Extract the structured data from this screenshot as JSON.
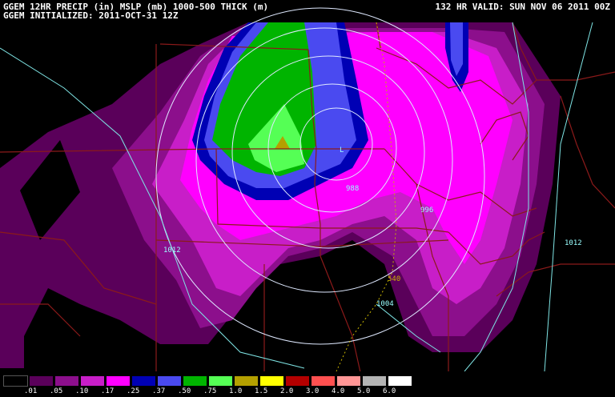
{
  "header": {
    "line1": "GGEM 12HR PRECIP (in) MSLP (mb) 1000-500 THICK (m)",
    "line2": "GGEM INITIALIZED: 2011-OCT-31 12Z",
    "valid": "132 HR VALID: SUN NOV 06 2011 00Z"
  },
  "map": {
    "pressure_center_symbol": "L",
    "isobar_labels": [
      "988",
      "996",
      "1004",
      "1012",
      "1012"
    ],
    "thickness_label": "540"
  },
  "legend": {
    "items": [
      {
        "label": ".01",
        "color": "#000000"
      },
      {
        "label": ".05",
        "color": "#5a005a"
      },
      {
        "label": ".10",
        "color": "#8c0f8c"
      },
      {
        "label": ".17",
        "color": "#c81ec8"
      },
      {
        "label": ".25",
        "color": "#ff00ff"
      },
      {
        "label": ".37",
        "color": "#0000b4"
      },
      {
        "label": ".50",
        "color": "#4a4af0"
      },
      {
        "label": ".75",
        "color": "#00b400"
      },
      {
        "label": "1.0",
        "color": "#55ff55"
      },
      {
        "label": "1.5",
        "color": "#b4a000"
      },
      {
        "label": "2.0",
        "color": "#ffff00"
      },
      {
        "label": "3.0",
        "color": "#b40000"
      },
      {
        "label": "4.0",
        "color": "#ff5050"
      },
      {
        "label": "5.0",
        "color": "#ff9696"
      },
      {
        "label": "6.0",
        "color": "#b4b4b4"
      },
      {
        "label": "",
        "color": "#ffffff"
      }
    ]
  }
}
